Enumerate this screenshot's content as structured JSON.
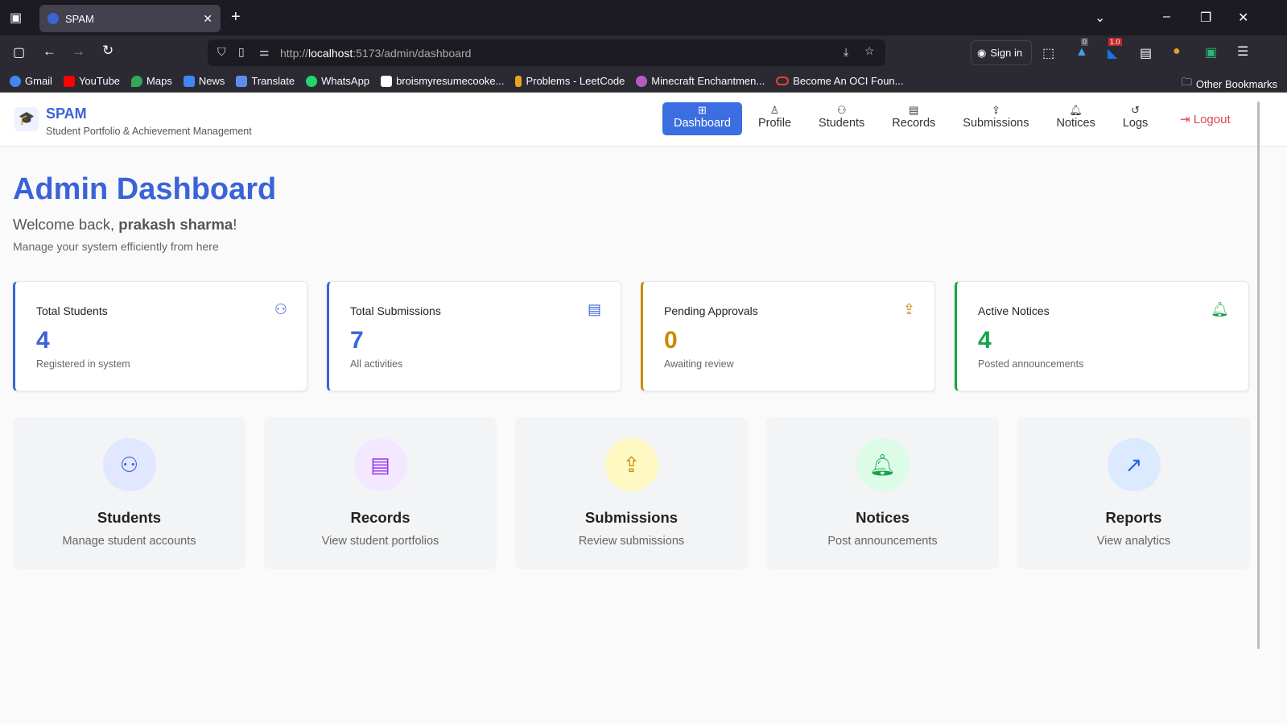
{
  "browser": {
    "tab_title": "SPAM",
    "url_host": "localhost",
    "url_prefix": "http://",
    "url_rest": ":5173/admin/dashboard",
    "sign_in": "Sign in",
    "badge_0": "0",
    "badge_1": "1.0",
    "bookmarks": [
      "Gmail",
      "YouTube",
      "Maps",
      "News",
      "Translate",
      "WhatsApp",
      "broismyresumecooke...",
      "Problems - LeetCode",
      "Minecraft Enchantmen...",
      "Become An OCI Foun..."
    ],
    "other_bookmarks": "Other Bookmarks"
  },
  "app": {
    "brand": "SPAM",
    "subtitle": "Student Portfolio & Achievement Management",
    "nav": [
      {
        "label": "Dashboard",
        "icon": "grid-icon"
      },
      {
        "label": "Profile",
        "icon": "user-icon"
      },
      {
        "label": "Students",
        "icon": "users-icon"
      },
      {
        "label": "Records",
        "icon": "file-icon"
      },
      {
        "label": "Submissions",
        "icon": "upload-icon"
      },
      {
        "label": "Notices",
        "icon": "bell-icon"
      },
      {
        "label": "Logs",
        "icon": "history-icon"
      }
    ],
    "logout": "Logout"
  },
  "page": {
    "title": "Admin Dashboard",
    "welcome_prefix": "Welcome back, ",
    "user": "prakash sharma",
    "welcome_suffix": "!",
    "subtitle": "Manage your system efficiently from here"
  },
  "stats": [
    {
      "label": "Total Students",
      "value": "4",
      "caption": "Registered in system",
      "color": "#3b63d8"
    },
    {
      "label": "Total Submissions",
      "value": "7",
      "caption": "All activities",
      "color": "#3b63d8"
    },
    {
      "label": "Pending Approvals",
      "value": "0",
      "caption": "Awaiting review",
      "color": "#ca8a04"
    },
    {
      "label": "Active Notices",
      "value": "4",
      "caption": "Posted announcements",
      "color": "#16a34a"
    }
  ],
  "actions": [
    {
      "title": "Students",
      "desc": "Manage student accounts"
    },
    {
      "title": "Records",
      "desc": "View student portfolios"
    },
    {
      "title": "Submissions",
      "desc": "Review submissions"
    },
    {
      "title": "Notices",
      "desc": "Post announcements"
    },
    {
      "title": "Reports",
      "desc": "View analytics"
    }
  ]
}
